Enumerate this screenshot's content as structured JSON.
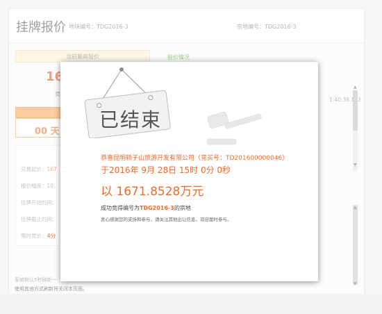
{
  "header": {
    "title": "挂牌报价",
    "block_label": "地块编号：",
    "block_value": "TDG2016-3",
    "land_label": "宗地编号：",
    "land_value": "TDG2016-3"
  },
  "left": {
    "current_price_label": "当前最高报价",
    "current_price_value": "167",
    "bidder_partial": "竞买人",
    "timer_partial": "00 天 0",
    "rows": [
      {
        "label": "交易起价：",
        "value": "167"
      },
      {
        "label": "报价幅度：",
        "value": "10."
      },
      {
        "label": "挂牌开始时间：",
        "value": ""
      },
      {
        "label": "挂牌截止时间：",
        "value": ""
      },
      {
        "label": "限时竞价：",
        "value": "4分"
      }
    ],
    "refresh_note": "系统默认5秒刷新一",
    "close_note": "使用其他方式刷新将关闭本页面。"
  },
  "right": {
    "record_tab": "报价情况",
    "record_time": "1:40:38.153"
  },
  "modal": {
    "stamp_text": "已结束",
    "buyer_line": "恭喜昆明轿子山旅游开发有限公司（竞买号：TD201600000046）",
    "time_line": "于2016年 9月 28日 15时 0分 0秒",
    "price_line": "以 1671.8528万元",
    "success_prefix": "成功竞得编号为",
    "success_code": "TDG2016-3",
    "success_suffix": "的宗地",
    "thanks_line": "衷心感谢您的支持和参与，请关注其他出让信息，欢迎届时参与。"
  },
  "colors": {
    "accent": "#ec6a2b",
    "tab_green": "#6db04a",
    "panel_orange": "#f7b16c"
  },
  "icons": [
    "hanging-sign-icon",
    "gavel-icon",
    "scroll-up-icon",
    "scroll-down-icon"
  ]
}
